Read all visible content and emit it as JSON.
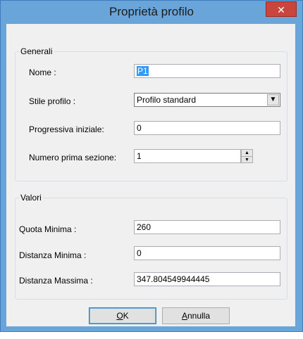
{
  "window": {
    "title": "Proprietà profilo",
    "close_glyph": "✕"
  },
  "generali": {
    "legend": "Generali",
    "nome_label": "Nome :",
    "nome_value": "P1",
    "stile_label": "Stile profilo :",
    "stile_value": "Profilo standard",
    "progressiva_label": "Progressiva iniziale:",
    "progressiva_value": "0",
    "numero_label": "Numero prima sezione:",
    "numero_value": "1"
  },
  "valori": {
    "legend": "Valori",
    "quota_label": "Quota Minima :",
    "quota_value": "260",
    "dmin_label": "Distanza Minima :",
    "dmin_value": "0",
    "dmax_label": "Distanza Massima :",
    "dmax_value": "347.804549944445"
  },
  "buttons": {
    "ok_mnemonic": "O",
    "ok_rest": "K",
    "annulla_mnemonic": "A",
    "annulla_rest": "nnulla"
  },
  "icons": {
    "combo_arrow": "chevron-down-icon",
    "spin_up": "chevron-up-icon",
    "spin_down": "chevron-down-icon",
    "close": "close-icon"
  }
}
